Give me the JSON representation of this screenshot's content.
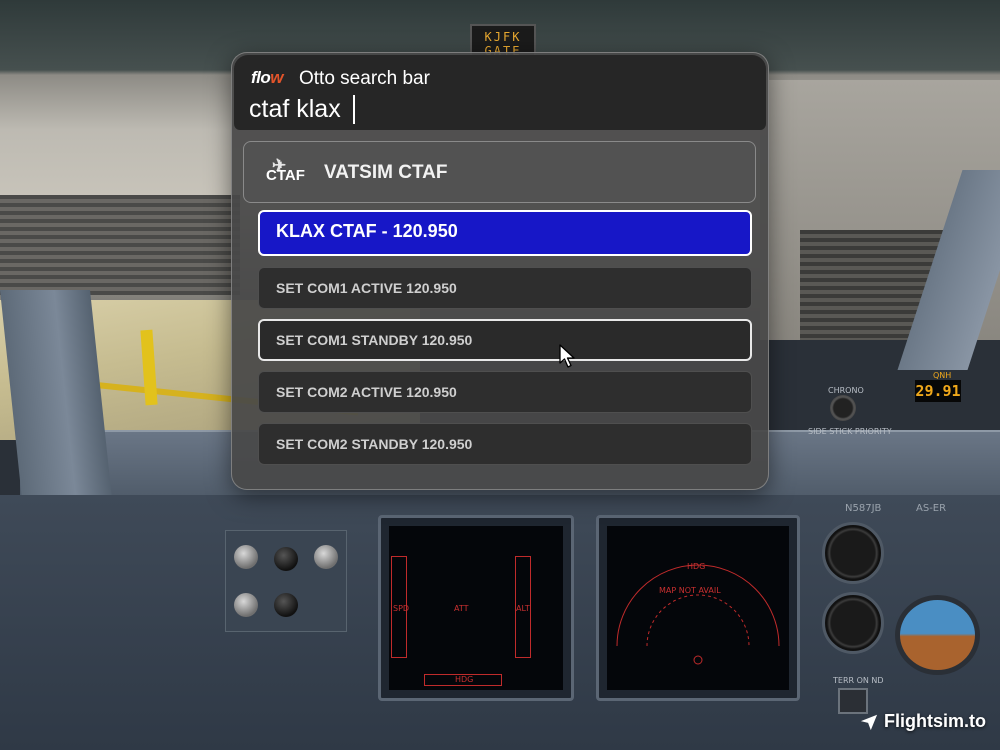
{
  "background": {
    "gate_sign": [
      "KJFK",
      "GATE"
    ],
    "qnh_label": "QNH",
    "qnh_value": "29.91",
    "tail_number": "N587JB",
    "aircraft_label": "AS-ER",
    "chrono_label": "CHRONO",
    "side_stick_label": "SIDE STICK PRIORITY",
    "pfd_labels": {
      "spd": "SPD",
      "att": "ATT",
      "alt": "ALT",
      "hdg": "HDG"
    },
    "nd_labels": {
      "hdg": "HDG",
      "map_not_avail": "MAP NOT AVAIL"
    },
    "terr_on_nd": "TERR ON ND",
    "watermark": "Flightsim.to"
  },
  "search": {
    "logo": "flo",
    "logo_accent": "w",
    "title": "Otto search bar",
    "query": "ctaf klax"
  },
  "plugin": {
    "icon_label": "CTAF",
    "icon": "plane-icon",
    "name": "VATSIM CTAF"
  },
  "results": [
    {
      "label": "KLAX CTAF - 120.950",
      "state": "selected"
    },
    {
      "label": "SET COM1 ACTIVE 120.950",
      "state": "normal"
    },
    {
      "label": "SET COM1 STANDBY 120.950",
      "state": "hovered"
    },
    {
      "label": "SET COM2 ACTIVE 120.950",
      "state": "normal"
    },
    {
      "label": "SET COM2 STANDBY 120.950",
      "state": "normal"
    }
  ],
  "colors": {
    "selected_result": "#1717c7",
    "header_bg": "#262626",
    "overlay_bg": "#484848",
    "logo_accent": "#e2542a"
  }
}
